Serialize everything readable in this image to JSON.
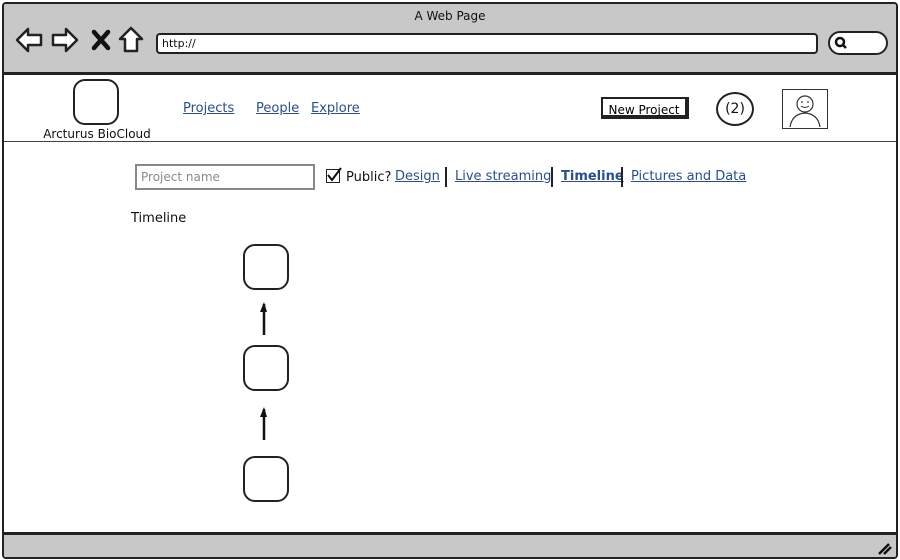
{
  "window": {
    "title": "A Web Page"
  },
  "browser": {
    "address": "http://",
    "icons": [
      "back-arrow-icon",
      "forward-arrow-icon",
      "close-x-icon",
      "home-icon",
      "search-icon"
    ]
  },
  "header": {
    "brand": "Arcturus BioCloud",
    "nav": [
      "Projects",
      "People",
      "Explore"
    ],
    "new_project_label": "New Project",
    "notification_count": "(2)"
  },
  "project": {
    "name_placeholder": "Project name",
    "public_label": "Public?",
    "public_checked": true
  },
  "tabs": [
    {
      "label": "Design",
      "active": false
    },
    {
      "label": "Live streaming",
      "active": false
    },
    {
      "label": "Timeline",
      "active": true
    },
    {
      "label": "Pictures and Data",
      "active": false
    }
  ],
  "timeline": {
    "title": "Timeline",
    "nodes": 3
  },
  "colors": {
    "link": "#2a4f8f",
    "chrome": "#c8c8c8",
    "ink": "#222222"
  }
}
